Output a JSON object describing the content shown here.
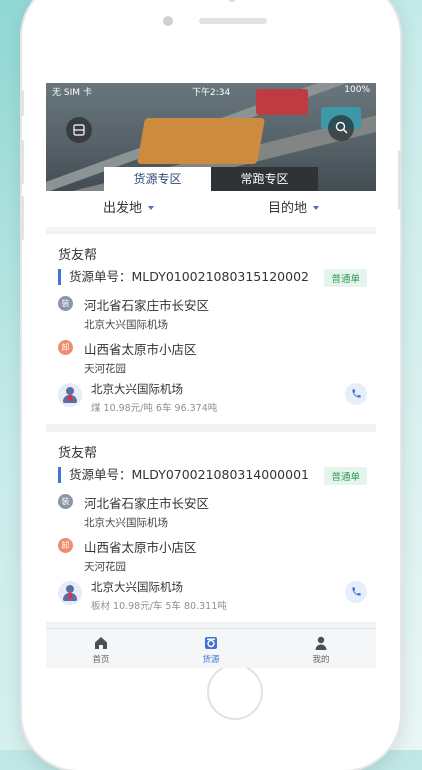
{
  "status_bar": {
    "carrier": "无 SIM 卡",
    "time": "下午2:34",
    "battery": "100%"
  },
  "hero": {
    "left_icon": "scan-card-icon",
    "right_icon": "search-icon",
    "tabs": [
      {
        "label": "货源专区",
        "active": true
      },
      {
        "label": "常跑专区",
        "active": false
      }
    ]
  },
  "filters": {
    "origin_label": "出发地",
    "destination_label": "目的地"
  },
  "cards": [
    {
      "company": "货友帮",
      "order_no": "货源单号：MLDY010021080315120002",
      "badge": "普通单",
      "load_icon_text": "装",
      "load_address": "河北省石家庄市长安区",
      "load_detail": "北京大兴国际机场",
      "unload_icon_text": "卸",
      "unload_address": "山西省太原市小店区",
      "unload_detail": "天河花园",
      "goods_title": "北京大兴国际机场",
      "goods_meta": "煤 10.98元/吨 6车 96.374吨"
    },
    {
      "company": "货友帮",
      "order_no": "货源单号：MLDY070021080314000001",
      "badge": "普通单",
      "load_icon_text": "装",
      "load_address": "河北省石家庄市长安区",
      "load_detail": "北京大兴国际机场",
      "unload_icon_text": "卸",
      "unload_address": "山西省太原市小店区",
      "unload_detail": "天河花园",
      "goods_title": "北京大兴国际机场",
      "goods_meta": "板材 10.98元/车 5车 80.311吨"
    }
  ],
  "tabbar": {
    "home": "首页",
    "goods": "货源",
    "mine": "我的",
    "active": "goods"
  },
  "colors": {
    "accent": "#3f74d6",
    "badge_bg": "#e6f5ec",
    "badge_text": "#2f9a5a"
  }
}
